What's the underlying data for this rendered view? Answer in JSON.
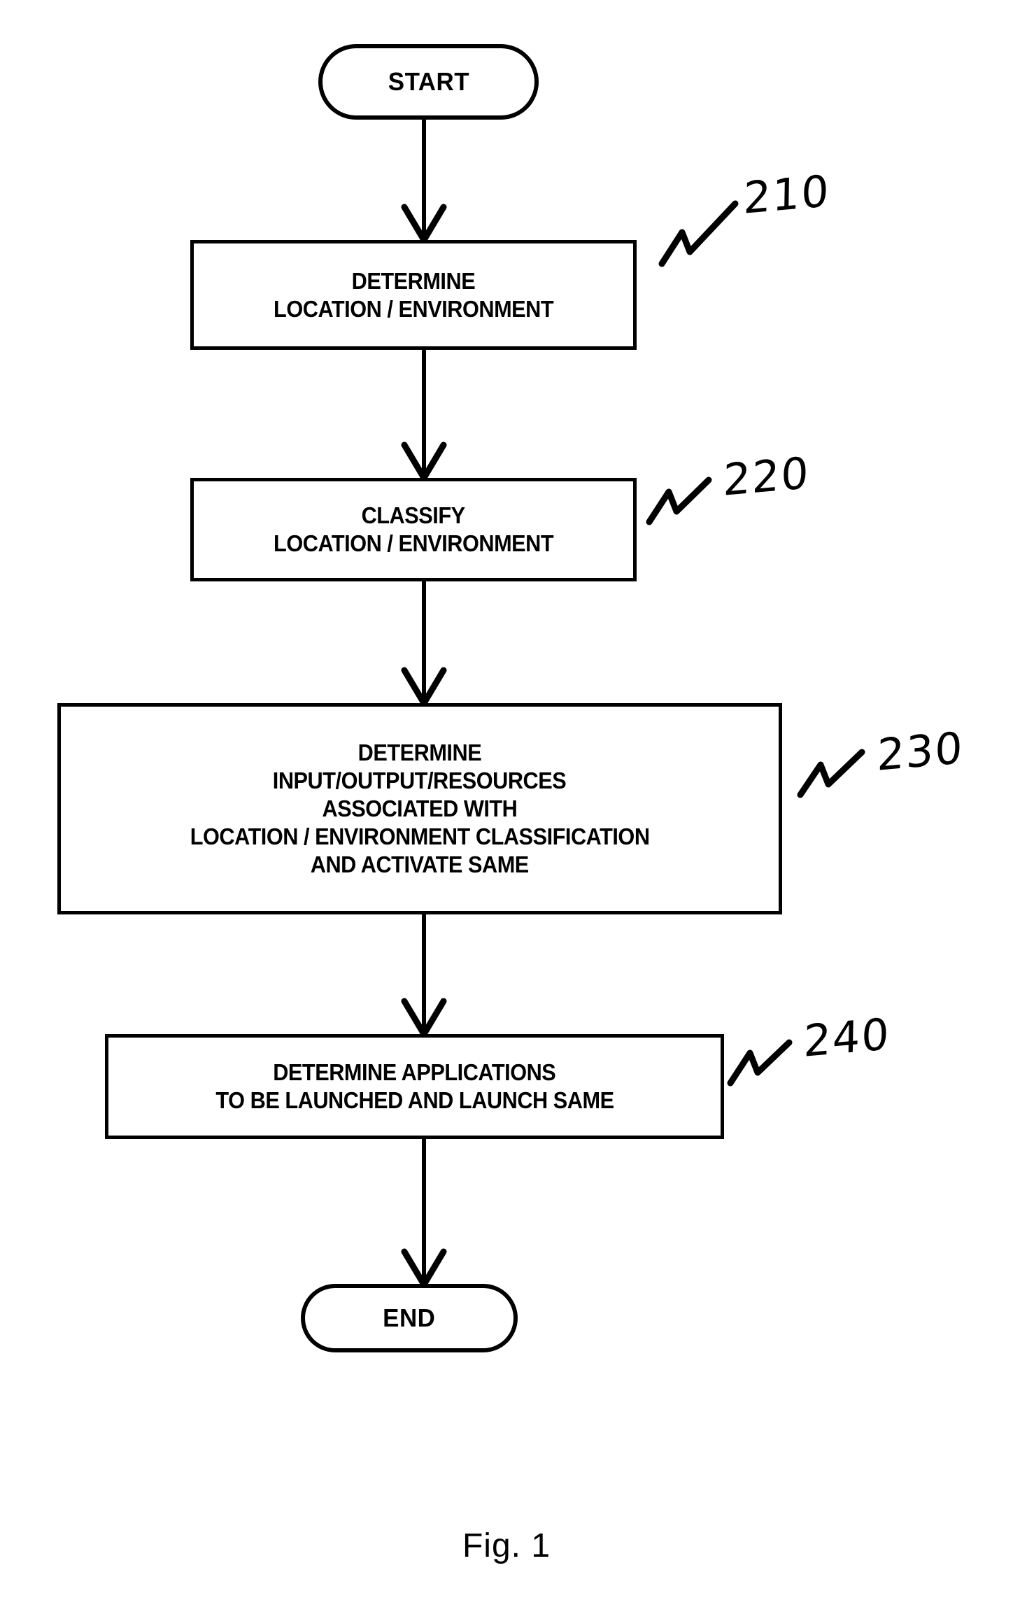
{
  "figure": {
    "caption": "Fig. 1",
    "type": "flowchart",
    "ink_color": "#000000",
    "background_color": "#ffffff"
  },
  "nodes": [
    {
      "id": "start",
      "shape": "terminal",
      "lines": [
        "START"
      ],
      "ref": null
    },
    {
      "id": "step-210",
      "shape": "process",
      "lines": [
        "DETERMINE",
        "LOCATION / ENVIRONMENT"
      ],
      "ref": "210"
    },
    {
      "id": "step-220",
      "shape": "process",
      "lines": [
        "CLASSIFY",
        "LOCATION / ENVIRONMENT"
      ],
      "ref": "220"
    },
    {
      "id": "step-230",
      "shape": "process",
      "lines": [
        "DETERMINE",
        "INPUT/OUTPUT/RESOURCES",
        "ASSOCIATED WITH",
        "LOCATION / ENVIRONMENT CLASSIFICATION",
        "AND ACTIVATE SAME"
      ],
      "ref": "230"
    },
    {
      "id": "step-240",
      "shape": "process",
      "lines": [
        "DETERMINE APPLICATIONS",
        "TO BE LAUNCHED AND LAUNCH SAME"
      ],
      "ref": "240"
    },
    {
      "id": "end",
      "shape": "terminal",
      "lines": [
        "END"
      ],
      "ref": null
    }
  ],
  "connectors": [
    {
      "id": "start-to-210",
      "from": "start",
      "to": "step-210",
      "arrowhead": "open-v"
    },
    {
      "id": "210-to-220",
      "from": "step-210",
      "to": "step-220",
      "arrowhead": "open-v"
    },
    {
      "id": "220-to-230",
      "from": "step-220",
      "to": "step-230",
      "arrowhead": "open-v"
    },
    {
      "id": "230-to-240",
      "from": "step-230",
      "to": "step-240",
      "arrowhead": "open-v"
    },
    {
      "id": "240-to-end",
      "from": "step-240",
      "to": "end",
      "arrowhead": "open-v"
    }
  ]
}
